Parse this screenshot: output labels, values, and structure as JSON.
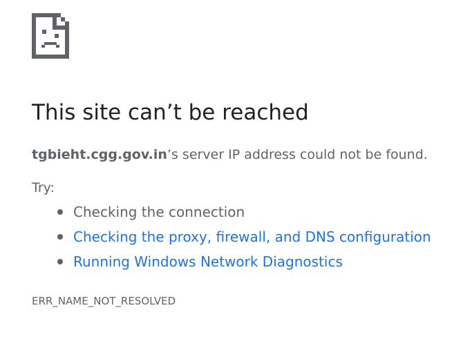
{
  "icon": {
    "name": "sad-page-icon"
  },
  "title": "This site can’t be reached",
  "summary": {
    "host": "tgbieht.cgg.gov.in",
    "message": "’s server IP address could not be found."
  },
  "try_label": "Try:",
  "suggestions": [
    {
      "label": "Checking the connection",
      "is_link": false
    },
    {
      "label": "Checking the proxy, firewall, and DNS configuration",
      "is_link": true
    },
    {
      "label": "Running Windows Network Diagnostics",
      "is_link": true
    }
  ],
  "error_code": "ERR_NAME_NOT_RESOLVED",
  "colors": {
    "title": "#202124",
    "body_text": "#5f6368",
    "link": "#1a73e8",
    "icon": "#5f6368"
  }
}
